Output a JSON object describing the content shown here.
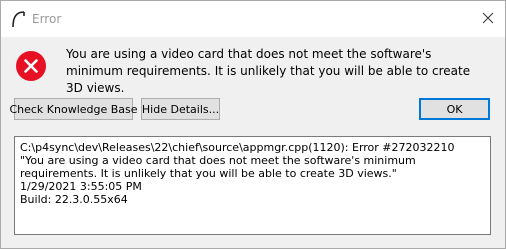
{
  "window": {
    "title": "Error"
  },
  "message": {
    "text": "You are using a video card that does not meet the software's minimum requirements. It is unlikely that you will be able to create 3D views."
  },
  "buttons": {
    "knowledge_base": "Check Knowledge Base",
    "hide_details": "Hide Details...",
    "ok": "OK"
  },
  "details": {
    "line1": "C:\\p4sync\\dev\\Releases\\22\\chief\\source\\appmgr.cpp(1120): Error #272032210",
    "line2": "\"You are using a video card that does not meet the software's minimum requirements. It is unlikely that you will be able to create 3D views.\"",
    "line3": "1/29/2021 3:55:05 PM",
    "line4": "Build: 22.3.0.55x64"
  },
  "icons": {
    "app": "app-logo-icon",
    "error": "error-icon",
    "close": "close-icon"
  },
  "colors": {
    "error_red": "#e81123",
    "focus_blue": "#0078d7"
  }
}
